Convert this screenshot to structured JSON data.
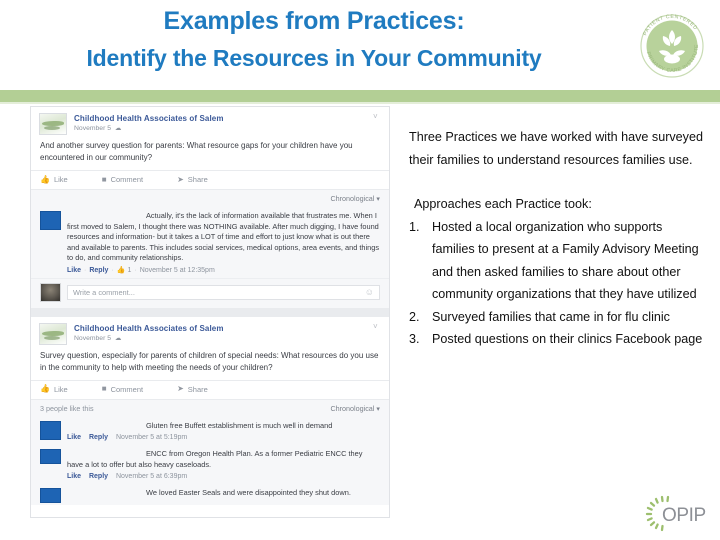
{
  "slide": {
    "title_line1": "Examples from Practices:",
    "title_line2": "Identify the Resources in Your Community"
  },
  "logos": {
    "pcpci": {
      "name": "patient-centered-primary-care-institute-logo",
      "text_top": "PATIENT CENTERED",
      "text_bottom": "PRIMARY CARE INSTITUTE"
    },
    "opip": {
      "name": "opip-logo",
      "text": "OPIP"
    }
  },
  "facebook_screenshot": {
    "posts": [
      {
        "page_name": "Childhood Health Associates of Salem",
        "date": "November 5",
        "privacy_icon": "globe-icon",
        "body": "And another survey question for parents: What resource gaps for your children have you encountered in our community?",
        "actions": [
          "Like",
          "Comment",
          "Share"
        ],
        "like_count": "",
        "sort_label": "Chronological",
        "comments": [
          {
            "author": "[redacted]",
            "text": "Actually, it's the lack of information available that frustrates me. When I first moved to Salem, I thought there was NOTHING available. After much digging, I have found resources and information- but it takes a LOT of time and effort to just know what is out there and available to parents. This includes social services, medical options, area events, and things to do, and community relationships.",
            "like": "Like",
            "reply": "Reply",
            "likes": "1",
            "timestamp": "November 5 at 12:35pm"
          }
        ],
        "write_placeholder": "Write a comment..."
      },
      {
        "page_name": "Childhood Health Associates of Salem",
        "date": "November 5",
        "privacy_icon": "globe-icon",
        "body": "Survey question, especially for parents of children of special needs: What resources do you use in the community to help with meeting the needs of your children?",
        "actions": [
          "Like",
          "Comment",
          "Share"
        ],
        "like_count": "3 people like this",
        "sort_label": "Chronological",
        "comments": [
          {
            "author": "[redacted]",
            "text": "Gluten free Buffett establishment is much well in demand",
            "like": "Like",
            "reply": "Reply",
            "likes": "",
            "timestamp": "November 5 at 5:19pm"
          },
          {
            "author": "[redacted]",
            "text": "ENCC from Oregon Health Plan. As a former Pediatric ENCC they have a lot to offer but also heavy caseloads.",
            "like": "Like",
            "reply": "Reply",
            "likes": "",
            "timestamp": "November 5 at 6:39pm"
          },
          {
            "author": "[redacted]",
            "text": "We loved Easter Seals and were disappointed they shut down.",
            "like": "",
            "reply": "",
            "likes": "",
            "timestamp": ""
          }
        ]
      }
    ]
  },
  "content": {
    "intro": "Three Practices we have worked with have surveyed their families to understand resources families use.",
    "approaches_heading": "Approaches each Practice took:",
    "steps": [
      {
        "num": "1.",
        "text": "Hosted a local organization who supports families to present at a Family Advisory Meeting and then asked families to share about other community organizations that they have utilized"
      },
      {
        "num": "2.",
        "text": "Surveyed families that came in for flu clinic"
      },
      {
        "num": "3.",
        "text": "Posted questions on their clinics Facebook page"
      }
    ]
  },
  "colors": {
    "title_blue": "#1f7bc0",
    "green_bar": "#b3cf95",
    "fb_blue": "#3b5998",
    "redaction_blue": "#1e64b4"
  }
}
